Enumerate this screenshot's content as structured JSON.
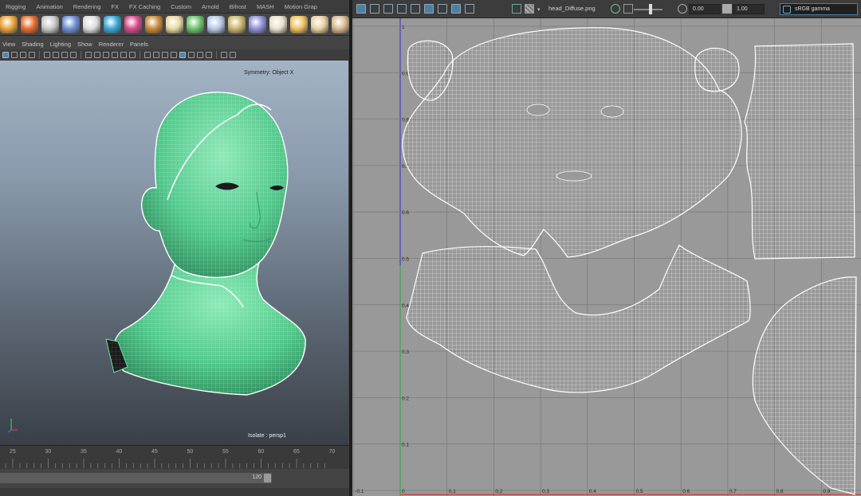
{
  "shelf": {
    "tabs": [
      "Rigging",
      "Animation",
      "Rendering",
      "FX",
      "FX Caching",
      "Custom",
      "Arnold",
      "Bifrost",
      "MASH",
      "Motion Grap"
    ],
    "icons": [
      "light-icon",
      "fire-icon",
      "ik-icon",
      "sphere-primitive-icon",
      "cone-icon",
      "water-icon",
      "flower-icon",
      "hair-icon",
      "globe-icon",
      "plant-icon",
      "particle-icon",
      "rope-icon",
      "sphere-material-icon",
      "dome-light-icon",
      "spot-light-icon",
      "skydome-icon",
      "area-light-icon"
    ]
  },
  "panel_menu": [
    "View",
    "Shading",
    "Lighting",
    "Show",
    "Renderer",
    "Panels"
  ],
  "viewport": {
    "symmetry": "Symmetry: Object X",
    "isolate": "Isolate : persp1"
  },
  "timeline": {
    "labels": [
      "25",
      "30",
      "35",
      "40",
      "45",
      "50",
      "55",
      "60",
      "65",
      "70"
    ],
    "range_end": "120"
  },
  "uv_editor": {
    "texture_name": "head_Diffuse.png",
    "exposure": "0.00",
    "gamma": "1.00",
    "color_space": "sRGB gamma",
    "v_labels": [
      "1",
      "0.9",
      "0.8",
      "0.7",
      "0.6",
      "0.5",
      "0.4",
      "0.3",
      "0.2",
      "0.1"
    ],
    "u_labels": [
      "-0.1",
      "0",
      "0.1",
      "0.2",
      "0.3",
      "0.4",
      "0.5",
      "0.6",
      "0.7",
      "0.8",
      "0.9"
    ]
  },
  "colors": {
    "mesh_highlight": "#6fe0a4",
    "uv_grid_bg": "#999999",
    "uv_wire": "#ffffff",
    "selection_blue": "#4f7fa0"
  }
}
